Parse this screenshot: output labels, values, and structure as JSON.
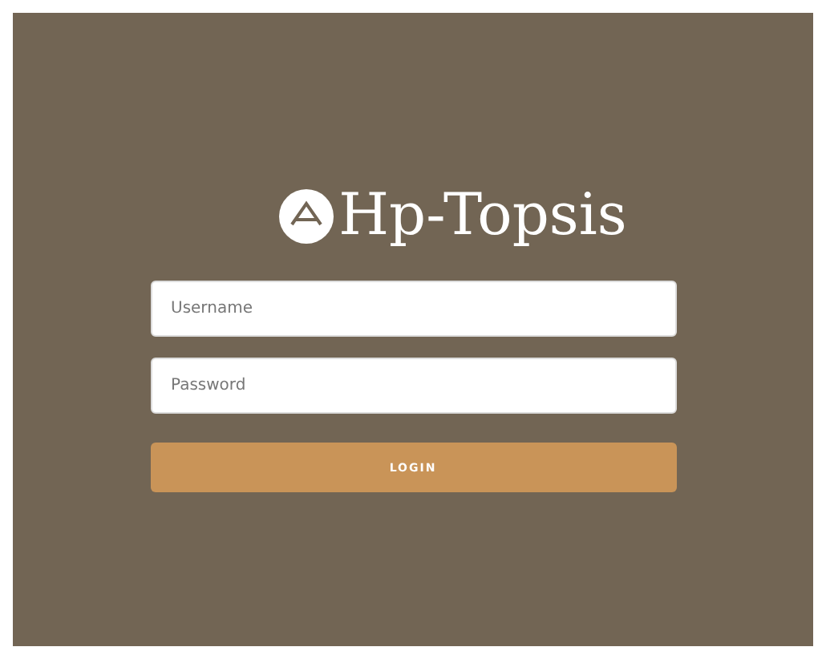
{
  "logo": {
    "title": "Hp-Topsis"
  },
  "fields": [
    {
      "placeholder": "Username"
    },
    {
      "placeholder": "Password"
    }
  ],
  "button": {
    "label": "LOGIN"
  }
}
